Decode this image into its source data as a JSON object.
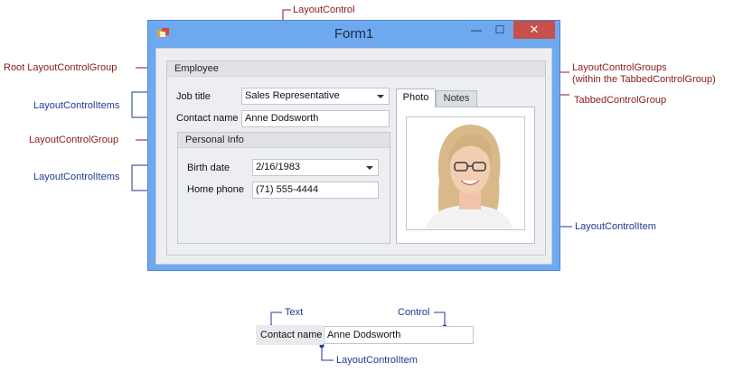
{
  "window": {
    "title": "Form1",
    "minimize": "—",
    "maximize": "☐",
    "close": "✕"
  },
  "employee_group": {
    "caption": "Employee",
    "job_title_label": "Job title",
    "job_title_value": "Sales Representative",
    "contact_name_label": "Contact name",
    "contact_name_value": "Anne Dodsworth"
  },
  "personal_info_group": {
    "caption": "Personal Info",
    "birth_date_label": "Birth date",
    "birth_date_value": "2/16/1983",
    "home_phone_label": "Home phone",
    "home_phone_value": "(71) 555-4444"
  },
  "tabs": [
    {
      "label": "Photo",
      "active": true
    },
    {
      "label": "Notes",
      "active": false
    }
  ],
  "annotations": {
    "layout_control": "LayoutControl",
    "root_group": "Root LayoutControlGroup",
    "items_1": "LayoutControlItems",
    "group": "LayoutControlGroup",
    "items_2": "LayoutControlItems",
    "tab_groups_line1": "LayoutControlGroups",
    "tab_groups_line2": "(within the TabbedControlGroup)",
    "tabbed_group": "TabbedControlGroup",
    "photo_item": "LayoutControlItem"
  },
  "demo": {
    "text_annotation": "Text",
    "control_annotation": "Control",
    "label": "Contact name",
    "value": "Anne Dodsworth",
    "item_annotation": "LayoutControlItem"
  },
  "colors": {
    "annotation_red": "#8b1a1a",
    "annotation_blue": "#1f3a93",
    "window_frame": "#6ea8ef",
    "close_button": "#c7504b"
  }
}
